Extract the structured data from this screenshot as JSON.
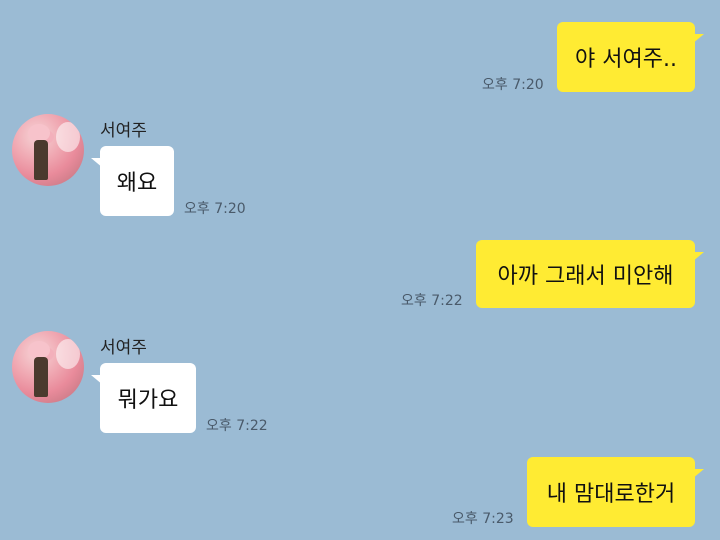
{
  "messages": [
    {
      "side": "mine",
      "text": "야 서여주..",
      "time": "오후 7:20"
    },
    {
      "side": "theirs",
      "sender": "서여주",
      "text": "왜요",
      "time": "오후 7:20"
    },
    {
      "side": "mine",
      "text": "아까 그래서 미안해",
      "time": "오후 7:22"
    },
    {
      "side": "theirs",
      "sender": "서여주",
      "text": "뭐가요",
      "time": "오후 7:22"
    },
    {
      "side": "mine",
      "text": "내 맘대로한거",
      "time": "오후 7:23"
    }
  ],
  "colors": {
    "background": "#9bbbd4",
    "my_bubble": "#ffeb33",
    "their_bubble": "#ffffff"
  },
  "icons": {
    "avatar": "profile-photo"
  }
}
